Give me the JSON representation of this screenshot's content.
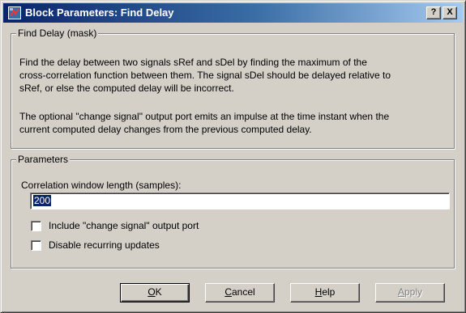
{
  "window": {
    "title": "Block Parameters: Find Delay",
    "help_button": "?",
    "close_button": "X"
  },
  "mask_group": {
    "legend": "Find Delay (mask)",
    "description_1": [
      "Find the delay between two signals sRef and sDel by finding the maximum of the",
      "cross-correlation function between them.  The signal sDel should be delayed relative to",
      "sRef, or else the computed delay will be incorrect."
    ],
    "description_2": [
      "The optional \"change signal\" output port emits an impulse at the time instant when the",
      "current computed delay changes from the previous computed delay."
    ]
  },
  "parameters": {
    "legend": "Parameters",
    "correlation_label": "Correlation window length (samples):",
    "correlation_value": "200",
    "checkboxes": [
      {
        "label": "Include \"change signal\" output port",
        "checked": false
      },
      {
        "label": "Disable recurring updates",
        "checked": false
      }
    ]
  },
  "buttons": {
    "ok": {
      "mnemonic": "O",
      "rest": "K"
    },
    "cancel": {
      "mnemonic": "C",
      "rest": "ancel"
    },
    "help": {
      "mnemonic": "H",
      "rest": "elp"
    },
    "apply": {
      "mnemonic": "A",
      "rest": "pply",
      "disabled": true
    }
  },
  "colors": {
    "titlebar_start": "#0a246a",
    "titlebar_end": "#a6caf0",
    "dialog_face": "#d4d0c8",
    "selection": "#0a246a"
  },
  "icons": {
    "title_icon": "simulink-block-icon"
  }
}
